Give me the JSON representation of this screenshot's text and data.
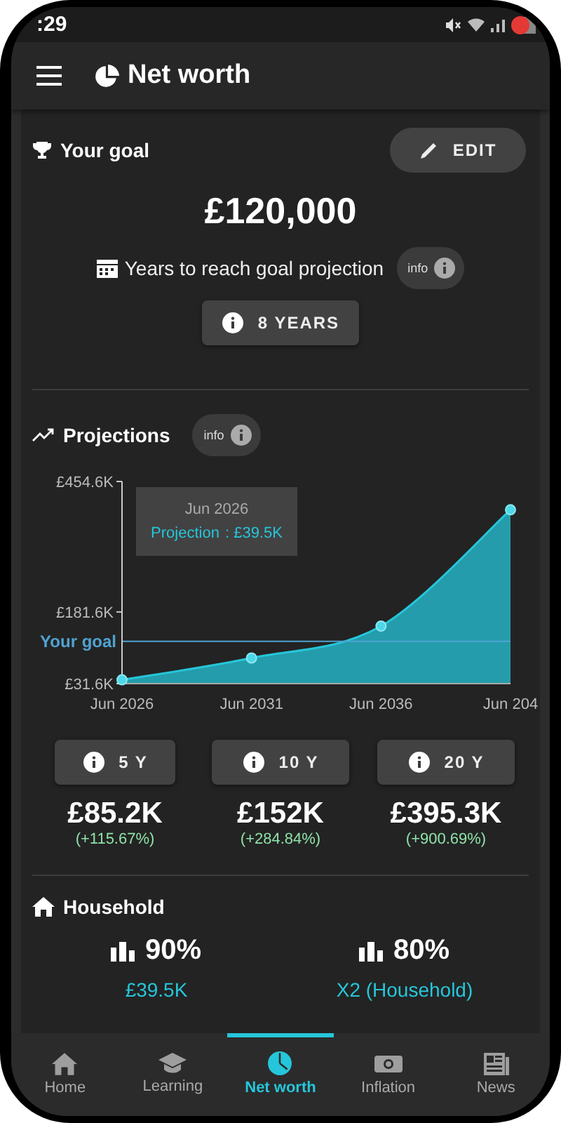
{
  "status_bar": {
    "time": ":29"
  },
  "app_bar": {
    "title": "Net worth"
  },
  "goal": {
    "title": "Your goal",
    "edit_button": "EDIT",
    "amount": "£120,000",
    "projection_label": "Years to reach goal projection",
    "info_button": "info",
    "years_button": "8 YEARS"
  },
  "projections": {
    "title": "Projections",
    "info_button": "info",
    "chart_data": {
      "type": "area",
      "categories": [
        "Jun 2026",
        "Jun 2031",
        "Jun 2036",
        "Jun 204"
      ],
      "series": [
        {
          "name": "Projection",
          "color": "#26c6da",
          "values": [
            39.5,
            85.2,
            152,
            395.3
          ]
        }
      ],
      "ylim": [
        31.6,
        454.6
      ],
      "yticks": [
        {
          "value": 31.6,
          "label": "£31.6K"
        },
        {
          "value": 181.6,
          "label": "£181.6K"
        },
        {
          "value": 454.6,
          "label": "£454.6K"
        }
      ],
      "ref_lines": [
        {
          "axis": "y",
          "value": 120,
          "label": "Your goal",
          "color": "#4fa3d1"
        }
      ]
    },
    "tooltip": {
      "title": "Jun 2026",
      "value": ": £39.5K"
    },
    "milestones": [
      {
        "button": "5 Y",
        "value": "£85.2K",
        "change": "(+115.67%)"
      },
      {
        "button": "10 Y",
        "value": "£152K",
        "change": "(+284.84%)"
      },
      {
        "button": "20 Y",
        "value": "£395.3K",
        "change": "(+900.69%)"
      }
    ]
  },
  "household": {
    "title": "Household",
    "stats": [
      {
        "percent": "90%",
        "label": "£39.5K"
      },
      {
        "percent": "80%",
        "label": "X2 (Household)"
      }
    ]
  },
  "nav": [
    {
      "label": "Home",
      "selected": false
    },
    {
      "label": "Learning",
      "selected": false
    },
    {
      "label": "Net worth",
      "selected": true
    },
    {
      "label": "Inflation",
      "selected": false
    },
    {
      "label": "News",
      "selected": false
    }
  ]
}
